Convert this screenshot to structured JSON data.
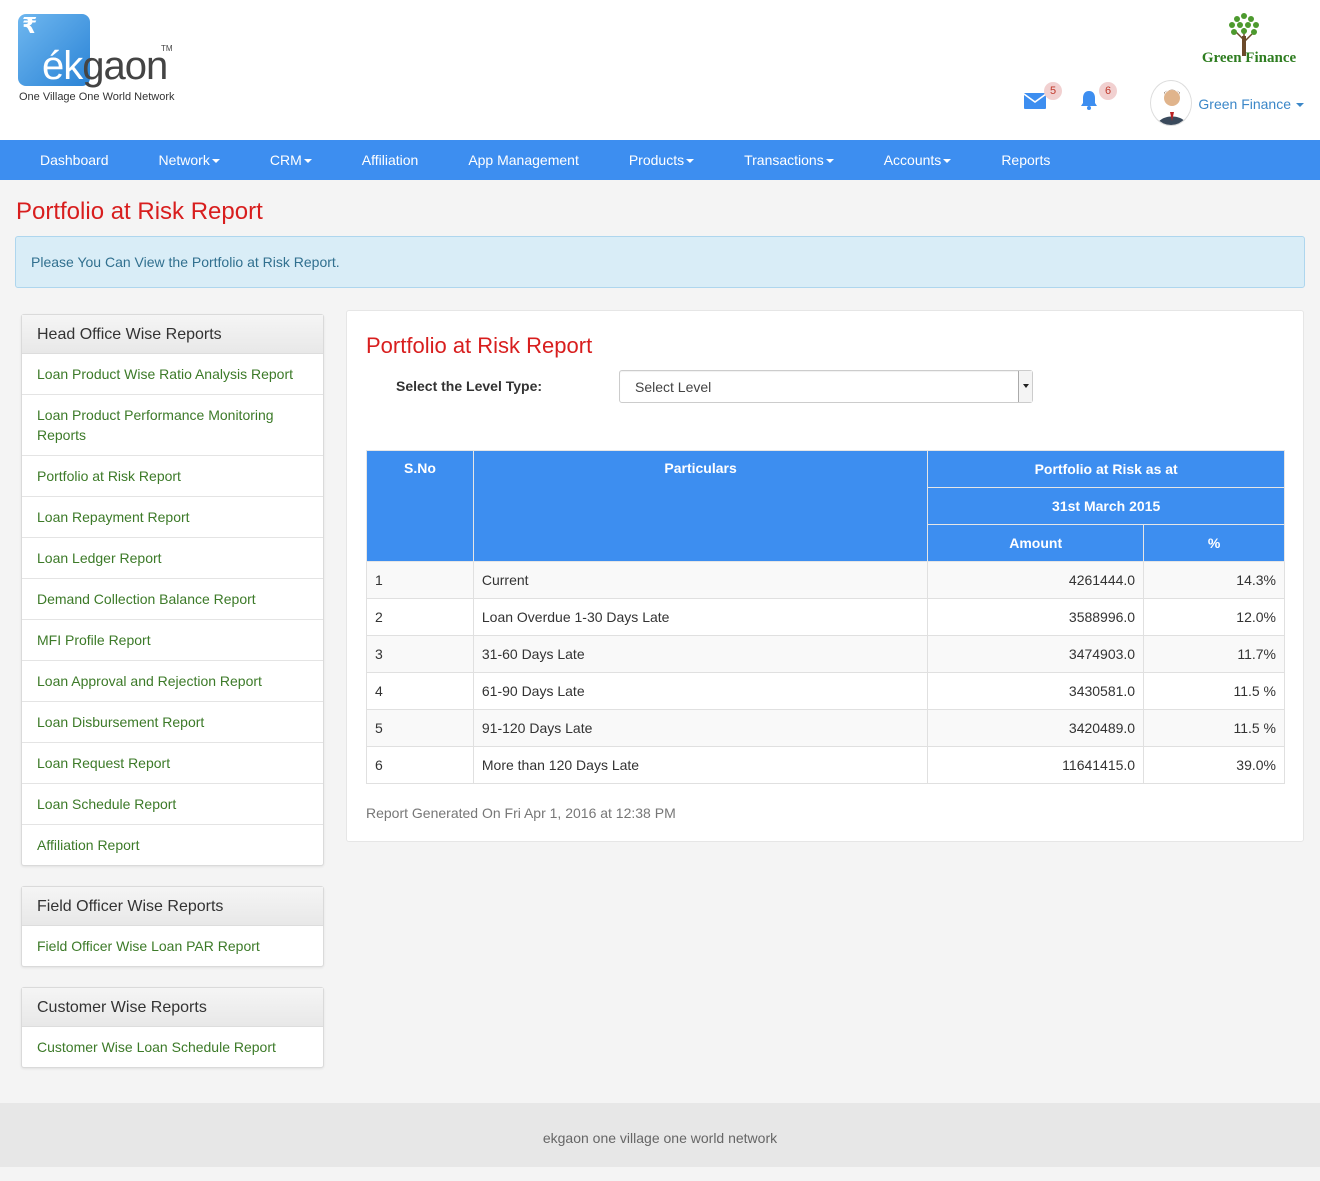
{
  "brand": {
    "rupee_symbol": "₹",
    "logo_ek": "ék",
    "logo_gaon": "gaon",
    "logo_tm": "TM",
    "tagline": "One Village One World Network"
  },
  "partner_logo": {
    "text": "Green Finance"
  },
  "header": {
    "mail_count": "5",
    "notification_count": "6",
    "user_name": "Green Finance"
  },
  "nav": {
    "items": [
      {
        "label": "Dashboard"
      },
      {
        "label": "Network"
      },
      {
        "label": "CRM"
      },
      {
        "label": "Affiliation"
      },
      {
        "label": "App Management"
      },
      {
        "label": "Products"
      },
      {
        "label": "Transactions"
      },
      {
        "label": "Accounts"
      },
      {
        "label": "Reports"
      }
    ]
  },
  "page": {
    "title": "Portfolio at Risk Report",
    "info": "Please You Can View the Portfolio at Risk Report."
  },
  "sidebar": {
    "head_office": {
      "heading": "Head Office Wise Reports",
      "links": [
        "Loan Product Wise Ratio Analysis Report",
        "Loan Product Performance Monitoring Reports",
        "Portfolio at Risk Report",
        "Loan Repayment Report",
        "Loan Ledger Report",
        "Demand Collection Balance Report",
        "MFI Profile Report",
        "Loan Approval and Rejection Report",
        "Loan Disbursement Report",
        "Loan Request Report",
        "Loan Schedule Report",
        "Affiliation Report"
      ]
    },
    "field_officer": {
      "heading": "Field Officer Wise Reports",
      "links": [
        "Field Officer Wise Loan PAR Report"
      ]
    },
    "customer": {
      "heading": "Customer Wise Reports",
      "links": [
        "Customer Wise Loan Schedule Report"
      ]
    }
  },
  "report": {
    "title": "Portfolio at Risk Report",
    "level_label": "Select the Level Type:",
    "level_selected": "Select Level",
    "table": {
      "headers": {
        "sno": "S.No",
        "particulars": "Particulars",
        "par_as_at": "Portfolio at Risk as at",
        "date": "31st March 2015",
        "amount": "Amount",
        "percent": "%"
      },
      "rows": [
        {
          "sno": "1",
          "particulars": "Current",
          "amount": "4261444.0",
          "percent": "14.3%"
        },
        {
          "sno": "2",
          "particulars": "Loan Overdue 1-30 Days Late",
          "amount": "3588996.0",
          "percent": "12.0%"
        },
        {
          "sno": "3",
          "particulars": "31-60 Days Late",
          "amount": "3474903.0",
          "percent": "11.7%"
        },
        {
          "sno": "4",
          "particulars": "61-90 Days Late",
          "amount": "3430581.0",
          "percent": "11.5 %"
        },
        {
          "sno": "5",
          "particulars": "91-120 Days Late",
          "amount": "3420489.0",
          "percent": "11.5 %"
        },
        {
          "sno": "6",
          "particulars": "More than 120 Days Late",
          "amount": "11641415.0",
          "percent": "39.0%"
        }
      ]
    },
    "generated": "Report Generated On Fri Apr 1, 2016 at 12:38 PM"
  },
  "footer": {
    "text": "ekgaon one village one world network"
  },
  "colors": {
    "nav_bg": "#3d8ef0",
    "title_red": "#d81e1e",
    "link_green": "#3c7a28",
    "alert_bg": "#d9edf7"
  },
  "icons": {
    "mail": "envelope-icon",
    "notifications": "bell-icon",
    "avatar": "user-avatar-icon",
    "tree": "tree-logo-icon"
  }
}
